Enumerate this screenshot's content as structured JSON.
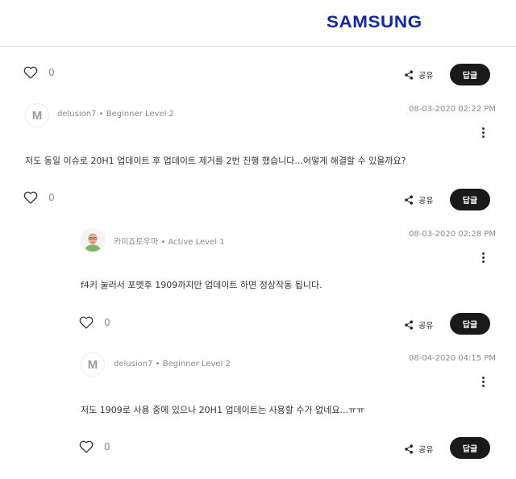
{
  "header": {
    "logo": "SAMSUNG"
  },
  "top_actions": {
    "like_count": "0",
    "share_label": "공유",
    "reply_label": "답글"
  },
  "posts": [
    {
      "author": "delusion7",
      "rank": "• Beginner Level 2",
      "date": "08-03-2020 02:22 PM",
      "body": "저도 동일 이슈로 20H1 업데이트 후 업데이트 제거를 2번 진행 했습니다...어떻게 해결할 수 있을까요?",
      "like_count": "0",
      "share_label": "공유",
      "reply_label": "답글"
    },
    {
      "author": "카미죠토우마",
      "rank": "• Active Level 1",
      "date": "08-03-2020 02:28 PM",
      "body": "f4키 눌러서 포멧후 1909까지만 업데이트 하면 정상작동 됩니다.",
      "like_count": "0",
      "share_label": "공유",
      "reply_label": "답글"
    },
    {
      "author": "delusion7",
      "rank": "• Beginner Level 2",
      "date": "08-04-2020 04:15 PM",
      "body": "저도 1909로 사용 중에 있으나 20H1 업데이트는 사용할 수가 없네요...ㅠㅠ",
      "like_count": "0",
      "share_label": "공유",
      "reply_label": "답글"
    }
  ]
}
